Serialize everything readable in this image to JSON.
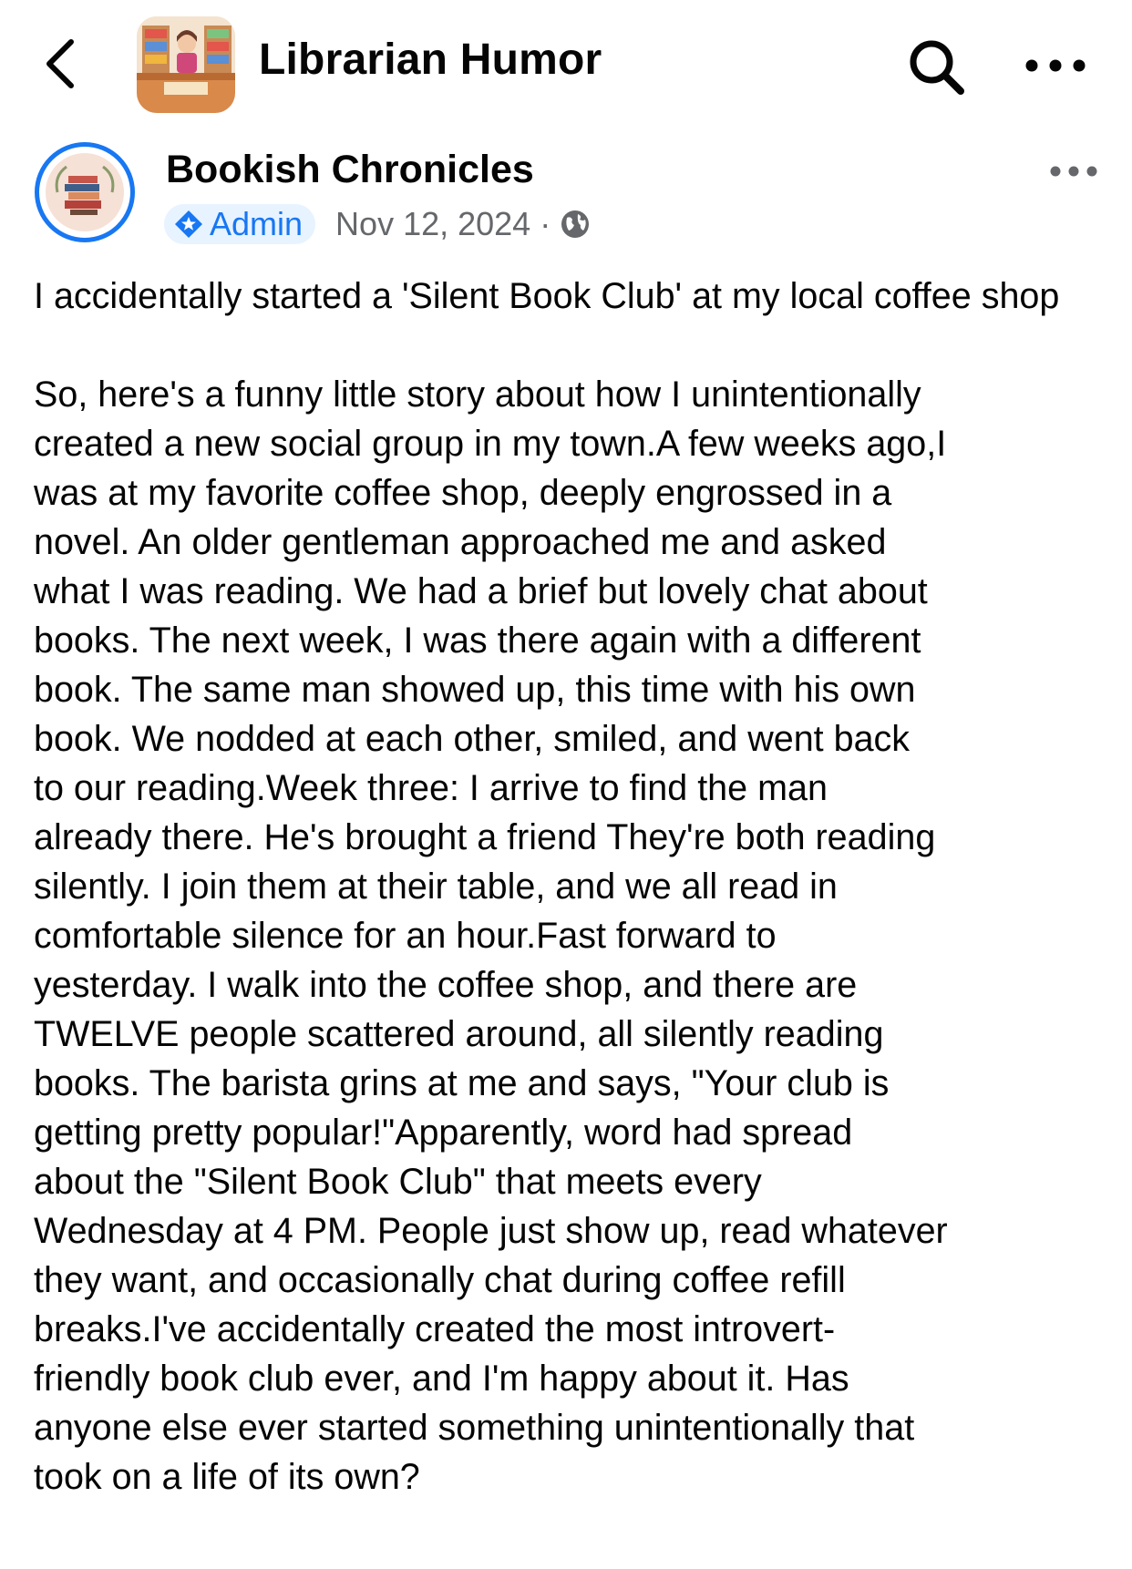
{
  "header": {
    "group_name": "Librarian Humor",
    "icons": [
      "back-chevron-icon",
      "group-avatar",
      "search-icon",
      "more-horizontal-icon"
    ]
  },
  "post": {
    "author": "Bookish Chronicles",
    "badge": "Admin",
    "date": "Nov 12, 2024",
    "separator": "·",
    "privacy_icon": "globe-icon",
    "title": "I accidentally started a 'Silent Book Club' at my local coffee shop",
    "lines": [
      "So, here's a funny little story about how I unintentionally",
      "created a new social group in my town.A few weeks ago,I",
      "was at my favorite coffee shop, deeply engrossed in a",
      "novel. An older gentleman approached me and asked",
      "what I was reading. We had a brief but lovely chat about",
      "books. The next week, I was there again with a different",
      "book. The same man showed up, this time with his own",
      "book. We nodded at each other, smiled, and went back",
      "to our reading.Week three: I arrive to find the man",
      "already there. He's brought a friend They're both reading",
      "silently. I join them at their table, and we all read in",
      "comfortable silence for an hour.Fast forward to",
      "yesterday. I walk into the coffee shop, and there are",
      "TWELVE people scattered around, all silently reading",
      "books. The barista grins at me and says, \"Your club is",
      "getting pretty popular!\"Apparently, word had spread",
      "about the \"Silent Book Club\" that meets every",
      "Wednesday at 4 PM. People just show up, read whatever",
      "they want, and occasionally chat during coffee refill",
      "breaks.I've accidentally created the most introvert-",
      "friendly book club ever, and I'm happy about it. Has",
      "anyone else ever started something unintentionally that",
      "took on a life of its own?"
    ]
  },
  "colors": {
    "accent": "#1877f2",
    "badge_bg": "#e7f3ff",
    "meta": "#65676b",
    "text": "#050505"
  }
}
